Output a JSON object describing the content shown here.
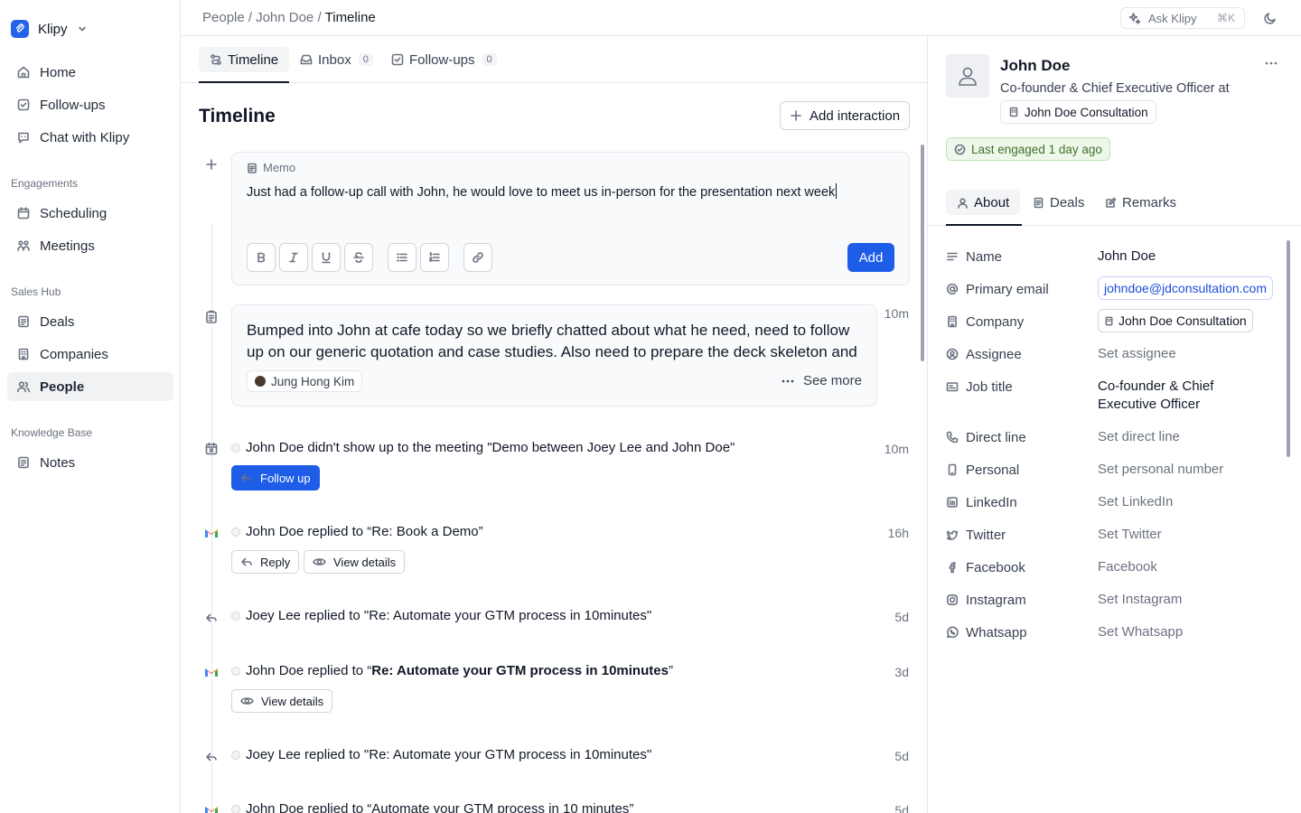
{
  "app": {
    "name": "Klipy"
  },
  "sidebar": {
    "top_items": [
      {
        "label": "Home",
        "icon": "home-icon"
      },
      {
        "label": "Follow-ups",
        "icon": "checkbox-icon"
      },
      {
        "label": "Chat with Klipy",
        "icon": "chat-bot-icon"
      }
    ],
    "sections": [
      {
        "title": "Engagements",
        "items": [
          {
            "label": "Scheduling"
          },
          {
            "label": "Meetings"
          }
        ]
      },
      {
        "title": "Sales Hub",
        "items": [
          {
            "label": "Deals"
          },
          {
            "label": "Companies"
          },
          {
            "label": "People"
          }
        ]
      },
      {
        "title": "Knowledge Base",
        "items": [
          {
            "label": "Notes"
          }
        ]
      }
    ],
    "active": "People"
  },
  "header": {
    "breadcrumb": [
      "People",
      "John Doe",
      "Timeline"
    ],
    "ask": {
      "label": "Ask Klipy",
      "shortcut": "⌘K"
    }
  },
  "center": {
    "tabs": [
      {
        "label": "Timeline",
        "count": null
      },
      {
        "label": "Inbox",
        "count": "0"
      },
      {
        "label": "Follow-ups",
        "count": "0"
      }
    ],
    "title": "Timeline",
    "add_interaction": "Add interaction",
    "memo": {
      "label": "Memo",
      "text": "Just had a follow-up call with John, he would love to meet us in-person for the presentation next week",
      "add_label": "Add"
    },
    "note_card": {
      "line1": "Bumped into John at cafe today so we briefly chatted about what he need, need to follow",
      "line2": "up on our generic quotation and case studies. Also need to prepare the deck skeleton and",
      "author": "Jung Hong Kim",
      "see_more": "See more",
      "time": "10m"
    },
    "events": [
      {
        "text": "John Doe didn't show up to the meeting \"Demo between Joey Lee and John Doe\"",
        "time": "10m",
        "action": "Follow up"
      },
      {
        "text_pre": "John Doe replied to “Re: Book a Demo”",
        "time": "16h",
        "actions": [
          "Reply",
          "View details"
        ]
      },
      {
        "text": "Joey Lee replied to \"Re: Automate your GTM process in 10minutes\"",
        "time": "5d"
      },
      {
        "text_pre": "John Doe replied to “",
        "bold": "Re: Automate your GTM process in 10minutes",
        "text_post": "”",
        "time": "3d",
        "actions": [
          "View details"
        ]
      },
      {
        "text": "Joey Lee replied to \"Re: Automate your GTM process in 10minutes\"",
        "time": "5d"
      },
      {
        "text": "John Doe replied to “Automate your GTM process in 10 minutes”",
        "time": "5d"
      }
    ]
  },
  "profile": {
    "name": "John Doe",
    "title": "Co-founder & Chief Executive Officer at",
    "company": "John Doe Consultation",
    "engaged": "Last engaged 1 day ago",
    "tabs": [
      "About",
      "Deals",
      "Remarks"
    ],
    "fields": [
      {
        "label": "Name",
        "value": "John Doe"
      },
      {
        "label": "Primary email",
        "value": "johndoe@jdconsultation.com"
      },
      {
        "label": "Company",
        "value": "John Doe Consultation"
      },
      {
        "label": "Assignee",
        "value": "Set assignee"
      },
      {
        "label": "Job title",
        "value": "Co-founder & Chief Executive Officer"
      },
      {
        "label": "Direct line",
        "value": "Set direct line"
      },
      {
        "label": "Personal",
        "value": "Set personal number"
      },
      {
        "label": "LinkedIn",
        "value": "Set LinkedIn"
      },
      {
        "label": "Twitter",
        "value": "Set Twitter"
      },
      {
        "label": "Facebook",
        "value": "Facebook"
      },
      {
        "label": "Instagram",
        "value": "Set Instagram"
      },
      {
        "label": "Whatsapp",
        "value": "Set Whatsapp"
      }
    ]
  },
  "colors": {
    "accent": "#1d5de8",
    "engaged_bg": "#eef8ea",
    "engaged_text": "#3f6f2a"
  }
}
